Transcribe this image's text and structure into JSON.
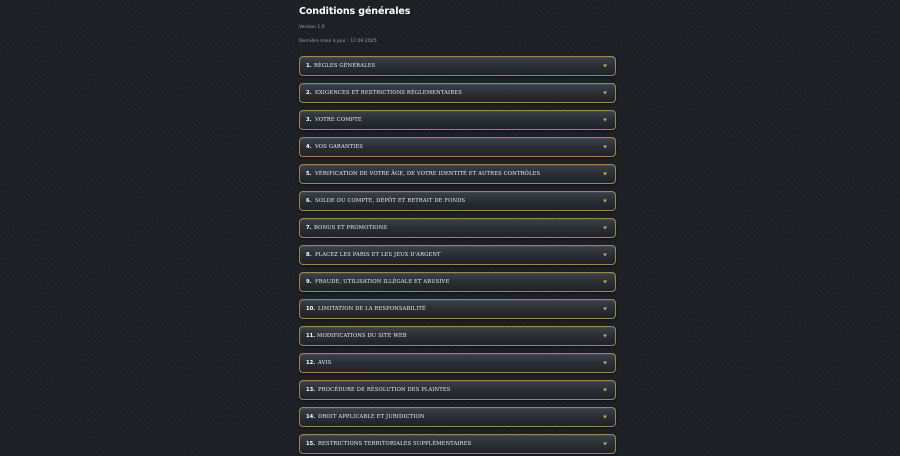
{
  "page": {
    "title": "Conditions générales",
    "version": "Version 1.0",
    "updated": "Dernière mise à jour : 17.09.2025"
  },
  "colors": {
    "background": "#1d2125",
    "item_border": "#9a8656",
    "chevron": "#c9a86a"
  },
  "sections": [
    {
      "number": "1.",
      "label": "RÈGLES GÉNÉRALES",
      "icon": "chevron-down-icon"
    },
    {
      "number": "2.",
      "label": "EXIGENCES ET RESTRICTIONS RÉGLEMENTAIRES",
      "icon": "chevron-down-icon"
    },
    {
      "number": "3.",
      "label": "VOTRE COMPTE",
      "icon": "chevron-down-icon"
    },
    {
      "number": "4.",
      "label": "VOS GARANTIES",
      "icon": "chevron-down-icon"
    },
    {
      "number": "5.",
      "label": "VÉRIFICATION DE VOTRE ÂGE, DE VOTRE IDENTITÉ ET AUTRES CONTRÔLES",
      "icon": "chevron-down-icon"
    },
    {
      "number": "6.",
      "label": "SOLDE DU COMPTE, DÉPÔT ET RETRAIT DE FONDS",
      "icon": "chevron-down-icon"
    },
    {
      "number": "7.",
      "label": "BONUS ET PROMOTIONS",
      "icon": "chevron-down-icon"
    },
    {
      "number": "8.",
      "label": "PLACEZ LES PARIS ET LES JEUX D'ARGENT",
      "icon": "chevron-down-icon"
    },
    {
      "number": "9.",
      "label": "FRAUDE, UTILISATION ILLÉGALE ET ABUSIVE",
      "icon": "chevron-down-icon"
    },
    {
      "number": "10.",
      "label": "LIMITATION DE LA RESPONSABILITÉ",
      "icon": "chevron-down-icon"
    },
    {
      "number": "11.",
      "label": "MODIFICATIONS DU SITE WEB",
      "icon": "chevron-down-icon"
    },
    {
      "number": "12.",
      "label": "AVIS",
      "icon": "chevron-down-icon"
    },
    {
      "number": "13.",
      "label": "PROCÉDURE DE RÉSOLUTION DES PLAINTES",
      "icon": "chevron-down-icon"
    },
    {
      "number": "14.",
      "label": "DROIT APPLICABLE ET JURIDICTION",
      "icon": "chevron-down-icon"
    },
    {
      "number": "15.",
      "label": "RESTRICTIONS TERRITORIALES SUPPLÉMENTAIRES",
      "icon": "chevron-down-icon"
    }
  ]
}
